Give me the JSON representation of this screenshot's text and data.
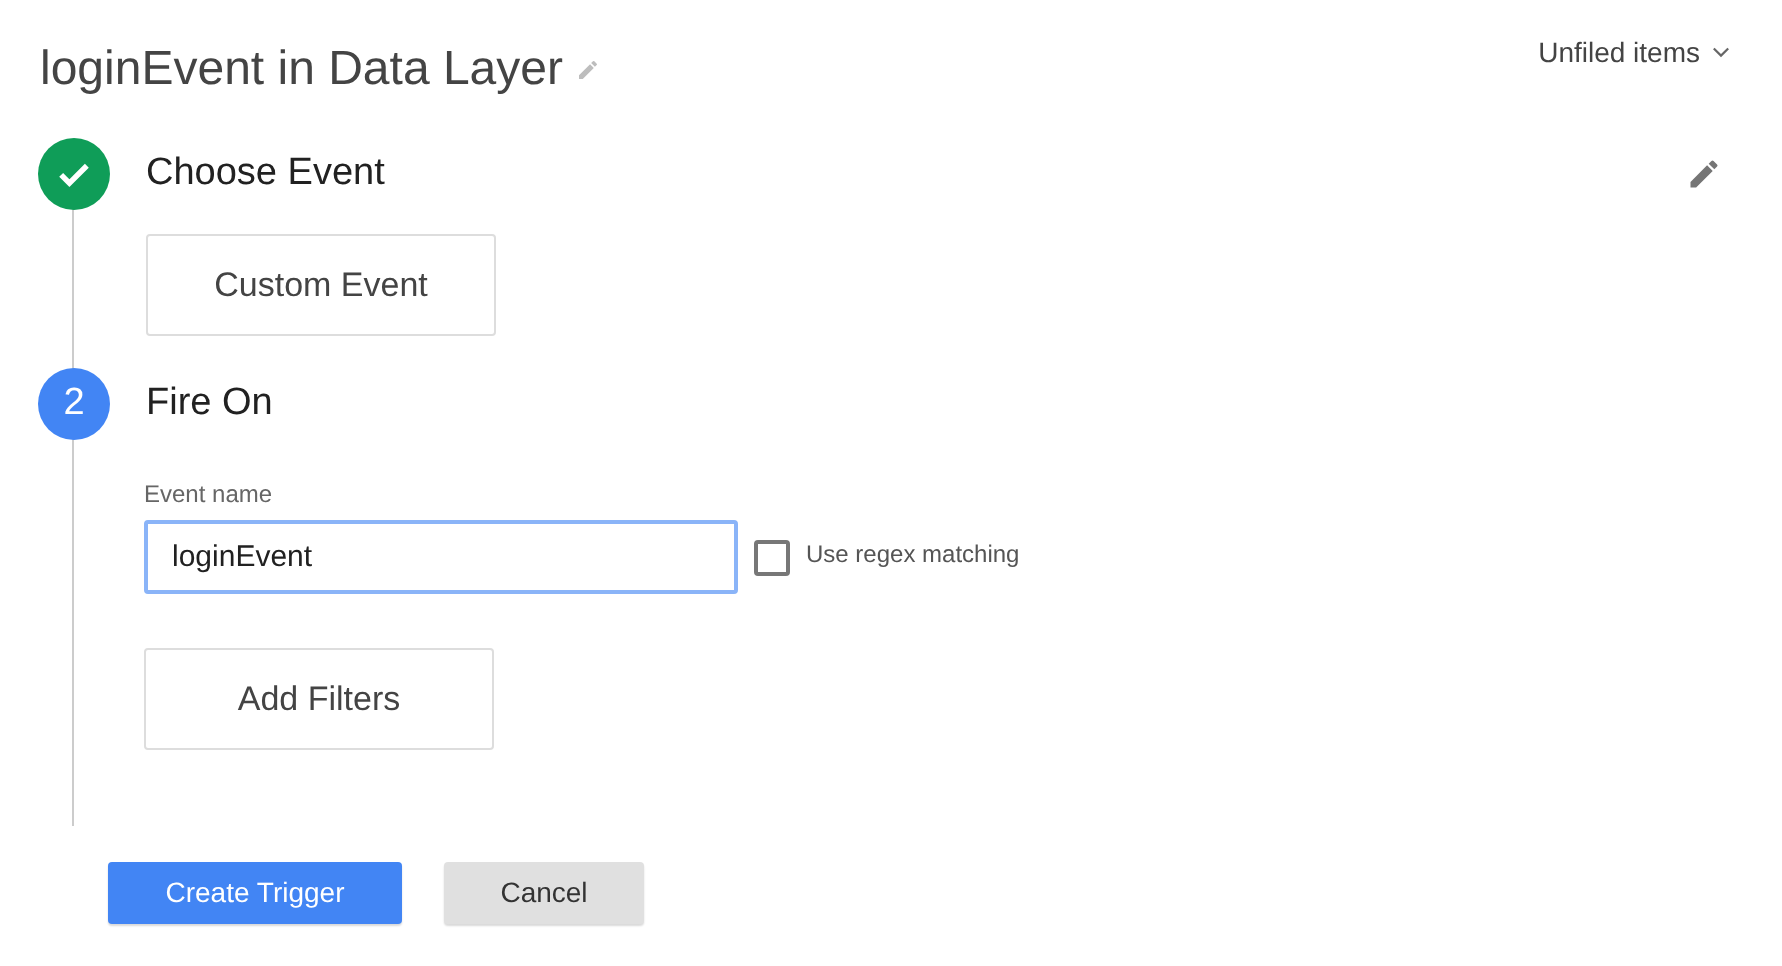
{
  "title": "loginEvent in Data Layer",
  "folder": "Unfiled items",
  "steps": [
    {
      "kind": "complete",
      "title": "Choose Event",
      "editable": true,
      "option": "Custom Event"
    },
    {
      "kind": "numbered",
      "number": "2",
      "title": "Fire On",
      "editable": false,
      "field": {
        "label": "Event name",
        "value": "loginEvent",
        "focused": true
      },
      "checkbox": {
        "label": "Use regex matching",
        "checked": false
      },
      "option": "Add Filters"
    }
  ],
  "buttons": [
    {
      "label": "Create Trigger",
      "kind": "primary"
    },
    {
      "label": "Cancel",
      "kind": "secondary"
    }
  ]
}
